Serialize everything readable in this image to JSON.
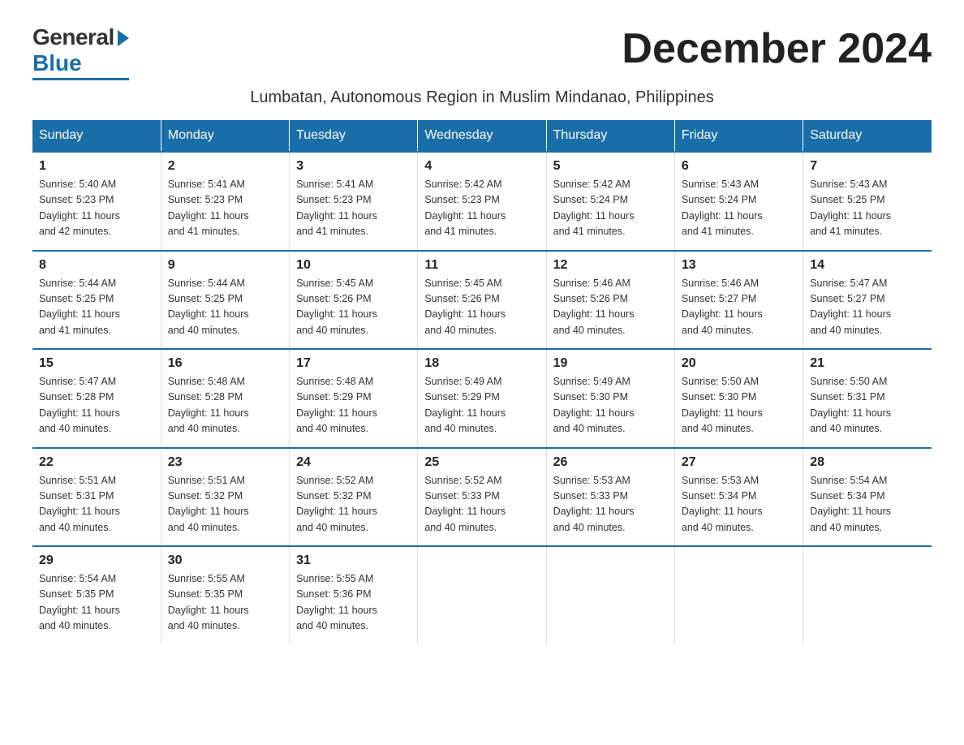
{
  "logo": {
    "general": "General",
    "blue": "Blue"
  },
  "title": "December 2024",
  "subtitle": "Lumbatan, Autonomous Region in Muslim Mindanao, Philippines",
  "days_of_week": [
    "Sunday",
    "Monday",
    "Tuesday",
    "Wednesday",
    "Thursday",
    "Friday",
    "Saturday"
  ],
  "weeks": [
    [
      {
        "day": "1",
        "info": "Sunrise: 5:40 AM\nSunset: 5:23 PM\nDaylight: 11 hours\nand 42 minutes."
      },
      {
        "day": "2",
        "info": "Sunrise: 5:41 AM\nSunset: 5:23 PM\nDaylight: 11 hours\nand 41 minutes."
      },
      {
        "day": "3",
        "info": "Sunrise: 5:41 AM\nSunset: 5:23 PM\nDaylight: 11 hours\nand 41 minutes."
      },
      {
        "day": "4",
        "info": "Sunrise: 5:42 AM\nSunset: 5:23 PM\nDaylight: 11 hours\nand 41 minutes."
      },
      {
        "day": "5",
        "info": "Sunrise: 5:42 AM\nSunset: 5:24 PM\nDaylight: 11 hours\nand 41 minutes."
      },
      {
        "day": "6",
        "info": "Sunrise: 5:43 AM\nSunset: 5:24 PM\nDaylight: 11 hours\nand 41 minutes."
      },
      {
        "day": "7",
        "info": "Sunrise: 5:43 AM\nSunset: 5:25 PM\nDaylight: 11 hours\nand 41 minutes."
      }
    ],
    [
      {
        "day": "8",
        "info": "Sunrise: 5:44 AM\nSunset: 5:25 PM\nDaylight: 11 hours\nand 41 minutes."
      },
      {
        "day": "9",
        "info": "Sunrise: 5:44 AM\nSunset: 5:25 PM\nDaylight: 11 hours\nand 40 minutes."
      },
      {
        "day": "10",
        "info": "Sunrise: 5:45 AM\nSunset: 5:26 PM\nDaylight: 11 hours\nand 40 minutes."
      },
      {
        "day": "11",
        "info": "Sunrise: 5:45 AM\nSunset: 5:26 PM\nDaylight: 11 hours\nand 40 minutes."
      },
      {
        "day": "12",
        "info": "Sunrise: 5:46 AM\nSunset: 5:26 PM\nDaylight: 11 hours\nand 40 minutes."
      },
      {
        "day": "13",
        "info": "Sunrise: 5:46 AM\nSunset: 5:27 PM\nDaylight: 11 hours\nand 40 minutes."
      },
      {
        "day": "14",
        "info": "Sunrise: 5:47 AM\nSunset: 5:27 PM\nDaylight: 11 hours\nand 40 minutes."
      }
    ],
    [
      {
        "day": "15",
        "info": "Sunrise: 5:47 AM\nSunset: 5:28 PM\nDaylight: 11 hours\nand 40 minutes."
      },
      {
        "day": "16",
        "info": "Sunrise: 5:48 AM\nSunset: 5:28 PM\nDaylight: 11 hours\nand 40 minutes."
      },
      {
        "day": "17",
        "info": "Sunrise: 5:48 AM\nSunset: 5:29 PM\nDaylight: 11 hours\nand 40 minutes."
      },
      {
        "day": "18",
        "info": "Sunrise: 5:49 AM\nSunset: 5:29 PM\nDaylight: 11 hours\nand 40 minutes."
      },
      {
        "day": "19",
        "info": "Sunrise: 5:49 AM\nSunset: 5:30 PM\nDaylight: 11 hours\nand 40 minutes."
      },
      {
        "day": "20",
        "info": "Sunrise: 5:50 AM\nSunset: 5:30 PM\nDaylight: 11 hours\nand 40 minutes."
      },
      {
        "day": "21",
        "info": "Sunrise: 5:50 AM\nSunset: 5:31 PM\nDaylight: 11 hours\nand 40 minutes."
      }
    ],
    [
      {
        "day": "22",
        "info": "Sunrise: 5:51 AM\nSunset: 5:31 PM\nDaylight: 11 hours\nand 40 minutes."
      },
      {
        "day": "23",
        "info": "Sunrise: 5:51 AM\nSunset: 5:32 PM\nDaylight: 11 hours\nand 40 minutes."
      },
      {
        "day": "24",
        "info": "Sunrise: 5:52 AM\nSunset: 5:32 PM\nDaylight: 11 hours\nand 40 minutes."
      },
      {
        "day": "25",
        "info": "Sunrise: 5:52 AM\nSunset: 5:33 PM\nDaylight: 11 hours\nand 40 minutes."
      },
      {
        "day": "26",
        "info": "Sunrise: 5:53 AM\nSunset: 5:33 PM\nDaylight: 11 hours\nand 40 minutes."
      },
      {
        "day": "27",
        "info": "Sunrise: 5:53 AM\nSunset: 5:34 PM\nDaylight: 11 hours\nand 40 minutes."
      },
      {
        "day": "28",
        "info": "Sunrise: 5:54 AM\nSunset: 5:34 PM\nDaylight: 11 hours\nand 40 minutes."
      }
    ],
    [
      {
        "day": "29",
        "info": "Sunrise: 5:54 AM\nSunset: 5:35 PM\nDaylight: 11 hours\nand 40 minutes."
      },
      {
        "day": "30",
        "info": "Sunrise: 5:55 AM\nSunset: 5:35 PM\nDaylight: 11 hours\nand 40 minutes."
      },
      {
        "day": "31",
        "info": "Sunrise: 5:55 AM\nSunset: 5:36 PM\nDaylight: 11 hours\nand 40 minutes."
      },
      {
        "day": "",
        "info": ""
      },
      {
        "day": "",
        "info": ""
      },
      {
        "day": "",
        "info": ""
      },
      {
        "day": "",
        "info": ""
      }
    ]
  ]
}
